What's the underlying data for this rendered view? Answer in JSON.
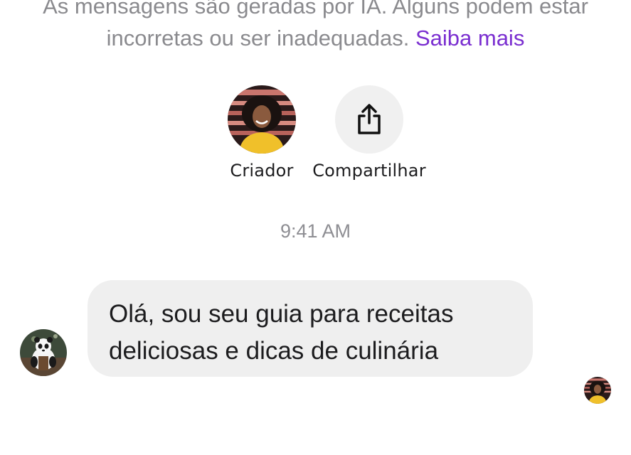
{
  "disclaimer": {
    "text": "As mensagens são geradas por IA. Alguns podem estar incorretas ou ser inadequadas.",
    "link": "Saiba mais"
  },
  "actions": [
    {
      "label": "Criador",
      "icon": "creator-avatar"
    },
    {
      "label": "Compartilhar",
      "icon": "share-icon"
    }
  ],
  "conversation": {
    "timestamp": "9:41 AM",
    "messages": [
      {
        "sender": "ai",
        "avatar": "panda-chef-avatar",
        "text": "Olá, sou seu guia para receitas deliciosas e dicas de culinária"
      }
    ],
    "read_receipt_avatar": "creator-avatar"
  },
  "colors": {
    "accent_link": "#7a2ed0",
    "bubble_bg": "#efefef",
    "muted_text": "#8a8a8e",
    "share_button_bg": "#f0f0f0"
  }
}
